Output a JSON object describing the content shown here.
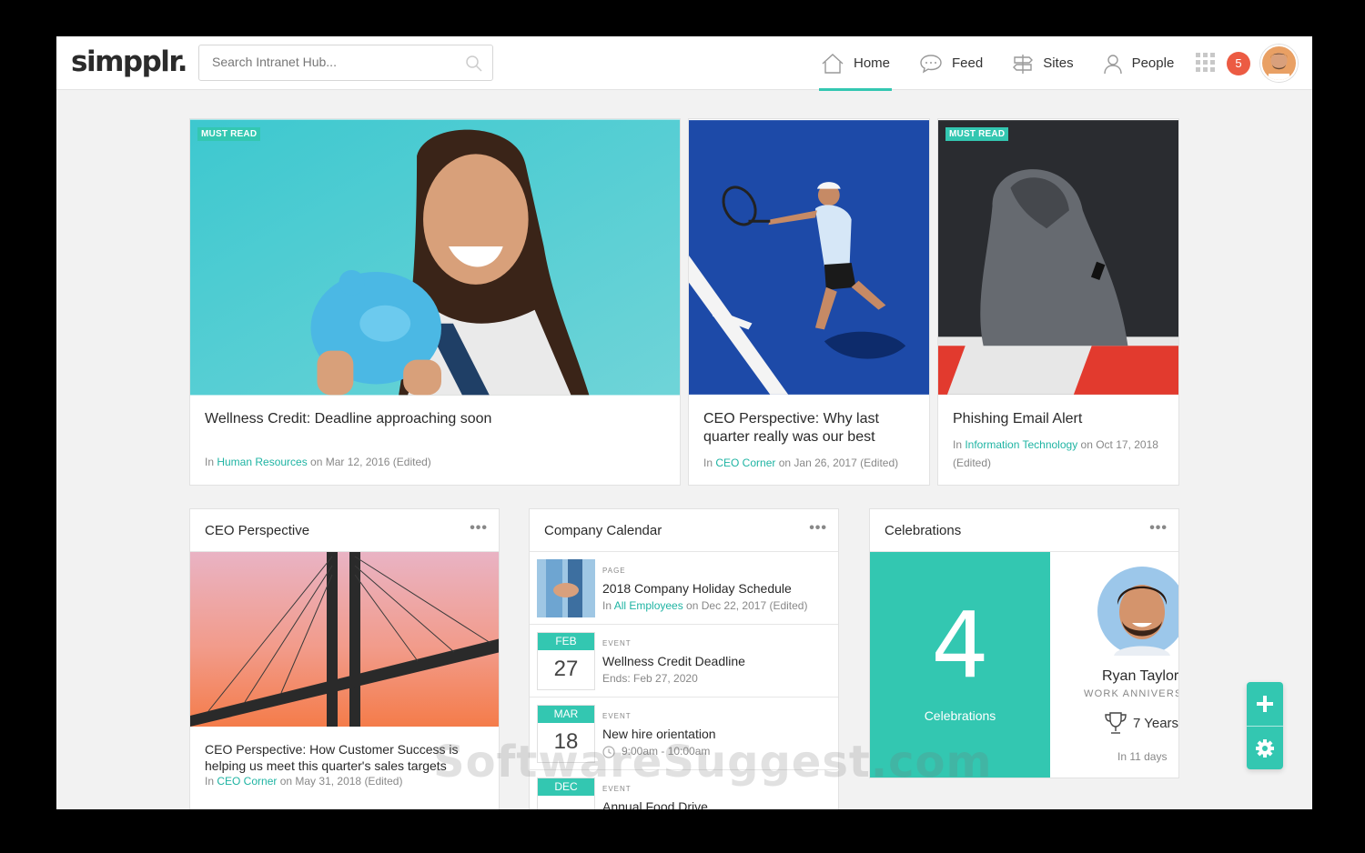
{
  "header": {
    "logo": "simpplr.",
    "search_placeholder": "Search Intranet Hub...",
    "nav": [
      {
        "label": "Home",
        "icon": "home-icon",
        "active": true
      },
      {
        "label": "Feed",
        "icon": "chat-bubble-icon"
      },
      {
        "label": "Sites",
        "icon": "signpost-icon"
      },
      {
        "label": "People",
        "icon": "person-icon"
      }
    ],
    "notification_count": "5",
    "accent_color": "#33c7b1"
  },
  "featured": [
    {
      "badge": "MUST READ",
      "title": "Wellness Credit: Deadline approaching soon",
      "meta_prefix": "In ",
      "site": "Human Resources",
      "meta_suffix": " on Mar 12, 2016 (Edited)"
    },
    {
      "badge": "",
      "title": "CEO Perspective: Why last quarter really was our best",
      "meta_prefix": "In ",
      "site": "CEO Corner",
      "meta_suffix": " on Jan 26, 2017 (Edited)"
    },
    {
      "badge": "MUST READ",
      "title": "Phishing Email Alert",
      "meta_prefix": "In ",
      "site": "Information Technology",
      "meta_suffix": " on Oct 17, 2018 (Edited)"
    }
  ],
  "ceo_widget": {
    "title": "CEO Perspective",
    "menu": "•••",
    "post_title": "CEO Perspective: How Customer Success is helping us meet this quarter's sales targets",
    "meta_prefix": "In ",
    "site": "CEO Corner",
    "meta_suffix": " on May 31, 2018 (Edited)"
  },
  "calendar_widget": {
    "title": "Company Calendar",
    "menu": "•••",
    "items": [
      {
        "type": "PAGE",
        "name": "2018 Company Holiday Schedule",
        "sub_prefix": "In ",
        "site": "All Employees",
        "sub_suffix": " on Dec 22, 2017 (Edited)"
      },
      {
        "type": "EVENT",
        "month": "FEB",
        "day": "27",
        "name": "Wellness Credit Deadline",
        "sub": "Ends: Feb 27, 2020"
      },
      {
        "type": "EVENT",
        "month": "MAR",
        "day": "18",
        "name": "New hire orientation",
        "sub": "9:00am - 10:00am"
      },
      {
        "type": "EVENT",
        "month": "DEC",
        "day": "",
        "name": "Annual Food Drive",
        "sub": ""
      }
    ]
  },
  "celebrations_widget": {
    "title": "Celebrations",
    "menu": "•••",
    "count": "4",
    "count_label": "Celebrations",
    "person_name": "Ryan Taylor",
    "occasion": "WORK ANNIVERSARY",
    "years": "7 Years",
    "when": "In 11 days"
  },
  "watermark": "SoftwareSuggest.com"
}
